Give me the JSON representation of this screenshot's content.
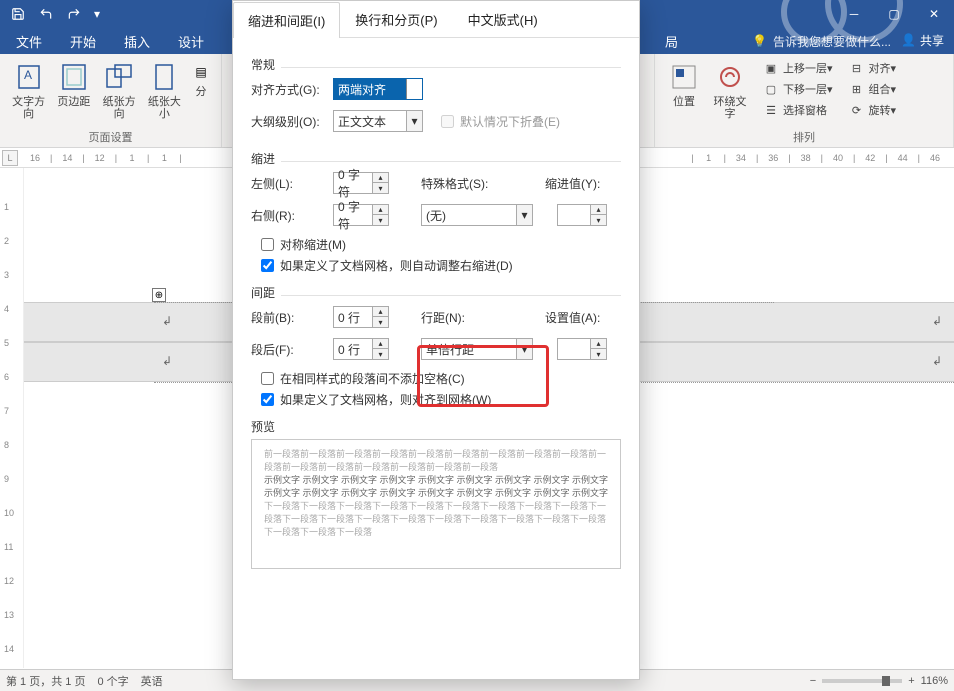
{
  "titlebar": {
    "search_placeholder": "告诉我您想要做什么...",
    "share": "共享"
  },
  "tabs": {
    "file": "文件",
    "home": "开始",
    "insert": "插入",
    "design": "设计",
    "layout_short": "局"
  },
  "ribbon": {
    "group_page_setup": "页面设置",
    "group_arrange": "排列",
    "btn_text_direction": "文字方向",
    "btn_margins": "页边距",
    "btn_orientation": "纸张方向",
    "btn_size": "纸张大小",
    "btn_columns": "分",
    "btn_position": "位置",
    "btn_wrap": "环绕文字",
    "btn_bring_forward": "上移一层",
    "btn_send_backward": "下移一层",
    "btn_selection_pane": "选择窗格",
    "btn_align": "对齐",
    "btn_group": "组合",
    "btn_rotate": "旋转"
  },
  "hruler_left": [
    "16",
    "14",
    "12",
    "1",
    "1"
  ],
  "hruler_right": [
    "1",
    "34",
    "36",
    "38",
    "40",
    "42",
    "44",
    "46"
  ],
  "dialog": {
    "tab_indent": "缩进和间距(I)",
    "tab_paging": "换行和分页(P)",
    "tab_chinese": "中文版式(H)",
    "general": "常规",
    "alignment": "对齐方式(G):",
    "alignment_val": "两端对齐",
    "outline": "大纲级别(O):",
    "outline_val": "正文文本",
    "collapse": "默认情况下折叠(E)",
    "indent": "缩进",
    "left": "左侧(L):",
    "right": "右侧(R):",
    "zero_char": "0 字符",
    "special": "特殊格式(S):",
    "special_val": "(无)",
    "indent_val": "缩进值(Y):",
    "mirror": "对称缩进(M)",
    "auto_adjust_indent": "如果定义了文档网格，则自动调整右缩进(D)",
    "spacing": "间距",
    "before": "段前(B):",
    "after": "段后(F):",
    "zero_line": "0 行",
    "line_spacing": "行距(N):",
    "line_spacing_val": "单倍行距",
    "setting_val": "设置值(A):",
    "no_space_same": "在相同样式的段落间不添加空格(C)",
    "snap_grid": "如果定义了文档网格，则对齐到网格(W)",
    "preview": "预览",
    "preview_grey": "前一段落前一段落前一段落前一段落前一段落前一段落前一段落前一段落前一段落前一段落前一段落前一段落前一段落前一段落前一段落前一段落",
    "preview_dark": "示例文字 示例文字 示例文字 示例文字 示例文字 示例文字 示例文字 示例文字 示例文字 示例文字 示例文字 示例文字 示例文字 示例文字 示例文字 示例文字 示例文字 示例文字",
    "preview_grey2": "下一段落下一段落下一段落下一段落下一段落下一段落下一段落下一段落下一段落下一段落下一段落下一段落下一段落下一段落下一段落下一段落下一段落下一段落下一段落下一段落下一段落下一段落"
  },
  "status": {
    "page": "第 1 页，共 1 页",
    "words": "0 个字",
    "lang": "英语",
    "zoom": "116%"
  }
}
